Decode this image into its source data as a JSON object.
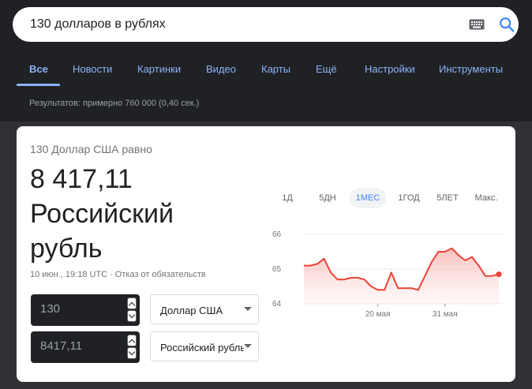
{
  "search": {
    "query": "130 долларов в рублях"
  },
  "tabs": [
    {
      "label": "Все"
    },
    {
      "label": "Новости"
    },
    {
      "label": "Картинки"
    },
    {
      "label": "Видео"
    },
    {
      "label": "Карты"
    },
    {
      "label": "Ещё"
    },
    {
      "label": "Настройки"
    },
    {
      "label": "Инструменты"
    }
  ],
  "results_stats": "Результатов: примерно 760 000 (0,40 сек.)",
  "converter": {
    "from_line": "130 Доллар США равно",
    "result_value": "8 417,11",
    "result_unit": "Российский рубль",
    "timestamp": "10 июн., 19:18 UTC",
    "separator": "·",
    "disclaimer": "Отказ от обязательств",
    "from_amount": "130",
    "from_currency": "Доллар США",
    "to_amount": "8417,11",
    "to_currency": "Российский рубль"
  },
  "period_tabs": [
    "1Д",
    "5ДН",
    "1МЕС",
    "1ГОД",
    "5ЛЕТ",
    "Макс."
  ],
  "active_period": "1МЕС",
  "colors": {
    "accent": "#8ab4f8",
    "line": "#ea4335",
    "fill": "#fce8e6",
    "page_bg": "#202124"
  },
  "chart_data": {
    "type": "area",
    "y_ticks": [
      "64",
      "65",
      "66"
    ],
    "ylim": [
      64,
      66
    ],
    "x_tick_labels": [
      "20 мая",
      "31 мая"
    ],
    "values": [
      65.1,
      65.1,
      65.15,
      65.3,
      64.9,
      64.7,
      64.7,
      64.75,
      64.75,
      64.7,
      64.5,
      64.4,
      64.4,
      64.9,
      64.45,
      64.45,
      64.45,
      64.4,
      64.8,
      65.2,
      65.5,
      65.5,
      65.6,
      65.4,
      65.25,
      65.35,
      65.1,
      64.8,
      64.8,
      64.85
    ],
    "grid": true
  }
}
